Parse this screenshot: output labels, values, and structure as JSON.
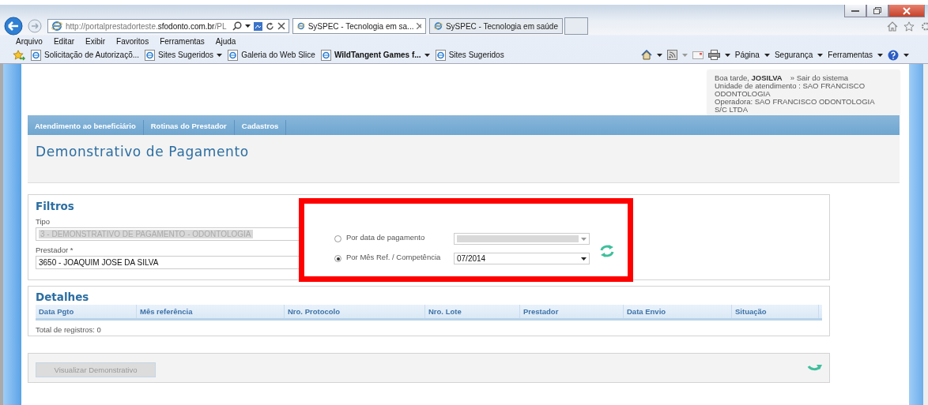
{
  "browser": {
    "address": "http://portalprestadorteste.**sfodonto.com.br**/PL",
    "tabs": [
      {
        "title": "SySPEC - Tecnologia em sa...",
        "selected": true,
        "closable": true
      },
      {
        "title": "SySPEC - Tecnologia em saúde",
        "selected": false,
        "closable": false
      }
    ],
    "menu": [
      "Arquivo",
      "Editar",
      "Exibir",
      "Favoritos",
      "Ferramentas",
      "Ajuda"
    ],
    "favorites": [
      {
        "label": "Solicitação de Autorizaçõ...",
        "dropdown": false,
        "bold": false
      },
      {
        "label": "Sites Sugeridos",
        "dropdown": true,
        "bold": false
      },
      {
        "label": "Galeria do Web Slice",
        "dropdown": false,
        "bold": false
      },
      {
        "label": "WildTangent Games f...",
        "dropdown": true,
        "bold": true
      },
      {
        "label": "Sites Sugeridos",
        "dropdown": false,
        "bold": false
      }
    ],
    "commands": [
      "Página",
      "Segurança",
      "Ferramentas"
    ]
  },
  "user": {
    "greeting": "Boa tarde, **JOSILVA**",
    "logout": "» Sair do sistema",
    "lines": [
      "Unidade de atendimento : SAO FRANCISCO ODONTOLOGIA",
      "Operadora: SAO FRANCISCO ODONTOLOGIA S/C LTDA"
    ]
  },
  "nav": [
    "Atendimento ao beneficiário",
    "Rotinas do Prestador",
    "Cadastros"
  ],
  "page_title": "Demonstrativo de Pagamento",
  "filters": {
    "title": "Filtros",
    "fields": [
      {
        "label": "Tipo",
        "value": "3 - DEMONSTRATIVO DE PAGAMENTO - ODONTOLOGIA",
        "disabled": true
      },
      {
        "label": "Prestador *",
        "value": "3650 - JOAQUIM JOSE DA SILVA",
        "disabled": false
      }
    ],
    "options": [
      {
        "label": "Por data de pagamento",
        "selected": false,
        "disabled": true
      },
      {
        "label": "Por Mês Ref. / Competência",
        "selected": true,
        "disabled": false,
        "value": "07/2014"
      }
    ]
  },
  "details": {
    "title": "Detalhes",
    "columns": [
      "Data Pgto",
      "Mês referência",
      "Nro. Protocolo",
      "Nro. Lote",
      "Prestador",
      "Data Envio",
      "Situação"
    ],
    "total": "Total de registros: 0"
  },
  "actions": {
    "button": {
      "label": "Visualizar Demonstrativo",
      "disabled": true
    }
  }
}
